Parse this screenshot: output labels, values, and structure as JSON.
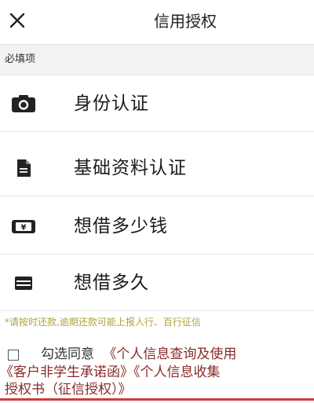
{
  "header": {
    "close_icon": "close-icon",
    "title": "信用授权"
  },
  "section": {
    "label": "必填项"
  },
  "items": [
    {
      "label": "身份认证",
      "icon": "camera-icon"
    },
    {
      "label": "基础资料认证",
      "icon": "document-icon"
    },
    {
      "label": "想借多少钱",
      "icon": "money-icon"
    },
    {
      "label": "想借多久",
      "icon": "card-icon"
    }
  ],
  "notice": "*请按时还款,逾期还款可能上报人行、百行征信",
  "agreement": {
    "checked": false,
    "prefix": "勾选同意",
    "links": [
      "《个人信息查询及使用",
      "《客户非学生承诺函》",
      "《个人信息收集",
      "授权书（征信授权）》"
    ]
  },
  "colors": {
    "notice": "#b0a23c",
    "link": "#8a2a2a",
    "accent_bar": "#d23a3a"
  }
}
